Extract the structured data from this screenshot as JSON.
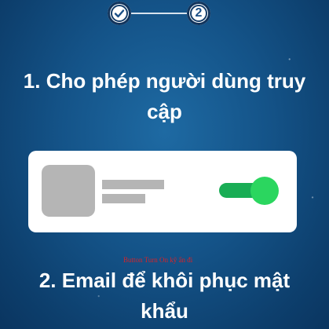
{
  "stepper": {
    "steps": [
      {
        "label": "",
        "state": "completed",
        "icon": "check-icon"
      },
      {
        "label": "2",
        "state": "current"
      }
    ]
  },
  "section1": {
    "title": "1. Cho phép người dùng truy cập"
  },
  "preview_card": {
    "toggle_state": "on",
    "toggle_color": "#2bd65f"
  },
  "hint_text": "Button Turn On kỹ ẩn đi",
  "section2": {
    "title": "2. Email để khôi phục mật khẩu"
  },
  "colors": {
    "background": "#145388",
    "card": "#ffffff",
    "placeholder": "#b5b5b5",
    "toggle_track": "#19ad55",
    "toggle_knob": "#2bd65f",
    "hint": "#d8232a"
  }
}
